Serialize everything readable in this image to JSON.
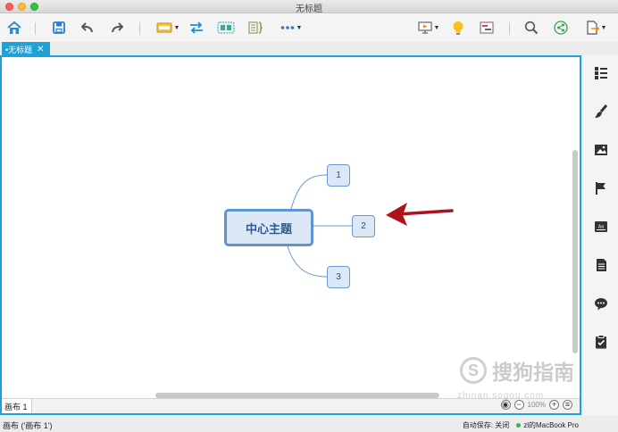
{
  "window": {
    "title": "无标题"
  },
  "tabs": [
    {
      "label": "•无标题",
      "close": "✕"
    }
  ],
  "map": {
    "central": "中心主题",
    "subtopics": [
      "1",
      "2",
      "3"
    ]
  },
  "sheet": {
    "tab_label": "画布 1",
    "zoom": "100%"
  },
  "status": {
    "left": "画布 ('画布 1')",
    "autosave": "自动保存: 关闭",
    "device": "zl的MacBook Pro"
  },
  "watermark": {
    "brand": "搜狗指南",
    "url": "zhinan.sogou.com"
  },
  "colors": {
    "accent": "#1fa0d6",
    "topic_border": "#6a98cc",
    "arrow": "#b0121b"
  }
}
